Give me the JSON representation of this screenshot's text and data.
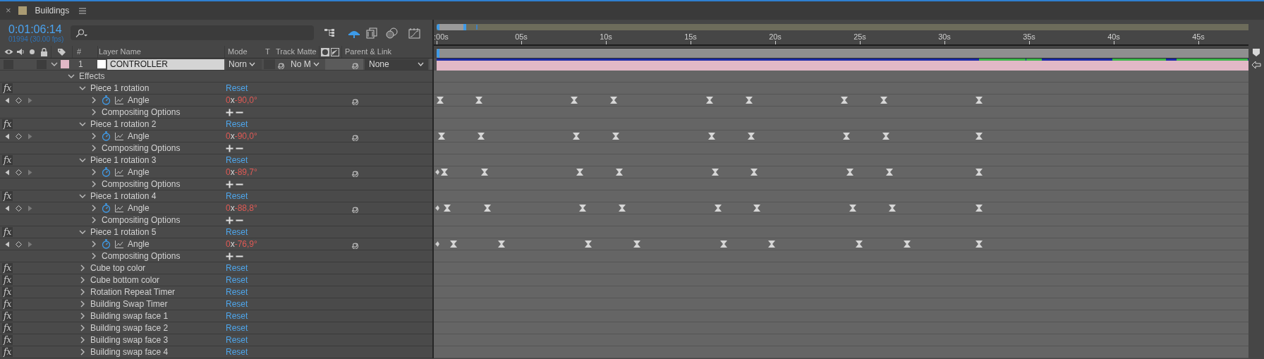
{
  "panel": {
    "close": "×",
    "title": "Buildings"
  },
  "timecode": "0:01:06:14",
  "frame_info": "01994 (30.00 fps)",
  "columns": {
    "number": "#",
    "layer_name": "Layer Name",
    "mode": "Mode",
    "t": "T",
    "track_matte": "Track Matte",
    "parent_link": "Parent & Link"
  },
  "ruler": [
    ":00s",
    "05s",
    "10s",
    "15s",
    "20s",
    "25s",
    "30s",
    "35s",
    "40s",
    "45s"
  ],
  "layer": {
    "number": "1",
    "name": "CONTROLLER",
    "expanded": true,
    "mode": "Norn",
    "track_matte": "No M",
    "parent": "None"
  },
  "effects": {
    "label": "Effects",
    "expanded": true,
    "items": [
      {
        "badge": "fx",
        "name": "Piece 1 rotation",
        "expanded": true,
        "reset": "Reset",
        "properties": [
          {
            "kind": "angle",
            "name": "Angle",
            "expanded": false,
            "animated": true,
            "revolutions": "0",
            "separator": "x",
            "degrees": "-90,0°"
          },
          {
            "kind": "compositing",
            "name": "Compositing Options",
            "expanded": false
          }
        ]
      },
      {
        "badge": "fx",
        "name": "Piece 1 rotation 2",
        "expanded": true,
        "reset": "Reset",
        "properties": [
          {
            "kind": "angle",
            "name": "Angle",
            "expanded": false,
            "animated": true,
            "revolutions": "0",
            "separator": "x",
            "degrees": "-90,0°"
          },
          {
            "kind": "compositing",
            "name": "Compositing Options",
            "expanded": false
          }
        ]
      },
      {
        "badge": "fx",
        "name": "Piece 1 rotation 3",
        "expanded": true,
        "reset": "Reset",
        "properties": [
          {
            "kind": "angle",
            "name": "Angle",
            "expanded": false,
            "animated": true,
            "revolutions": "0",
            "separator": "x",
            "degrees": "-89,7°"
          },
          {
            "kind": "compositing",
            "name": "Compositing Options",
            "expanded": false
          }
        ]
      },
      {
        "badge": "fx",
        "name": "Piece 1 rotation 4",
        "expanded": true,
        "reset": "Reset",
        "properties": [
          {
            "kind": "angle",
            "name": "Angle",
            "expanded": false,
            "animated": true,
            "revolutions": "0",
            "separator": "x",
            "degrees": "-88,8°"
          },
          {
            "kind": "compositing",
            "name": "Compositing Options",
            "expanded": false
          }
        ]
      },
      {
        "badge": "fx",
        "name": "Piece 1 rotation 5",
        "expanded": true,
        "reset": "Reset",
        "properties": [
          {
            "kind": "angle",
            "name": "Angle",
            "expanded": false,
            "animated": true,
            "revolutions": "0",
            "separator": "x",
            "degrees": "-76,9°"
          },
          {
            "kind": "compositing",
            "name": "Compositing Options",
            "expanded": false
          }
        ]
      },
      {
        "badge": "fx",
        "name": "Cube top color",
        "expanded": false,
        "reset": "Reset"
      },
      {
        "badge": "fx",
        "name": "Cube bottom color",
        "expanded": false,
        "reset": "Reset"
      },
      {
        "badge": "fx",
        "name": "Rotation Repeat Timer",
        "expanded": false,
        "reset": "Reset"
      },
      {
        "badge": "fx",
        "name": "Building Swap Timer",
        "expanded": false,
        "reset": "Reset"
      },
      {
        "badge": "fx",
        "name": "Building swap face 1",
        "expanded": false,
        "reset": "Reset"
      },
      {
        "badge": "fx",
        "name": "Building swap face 2",
        "expanded": false,
        "reset": "Reset"
      },
      {
        "badge": "fx",
        "name": "Building swap face 3",
        "expanded": false,
        "reset": "Reset"
      },
      {
        "badge": "fx",
        "name": "Building swap face 4",
        "expanded": false,
        "reset": "Reset"
      }
    ]
  }
}
